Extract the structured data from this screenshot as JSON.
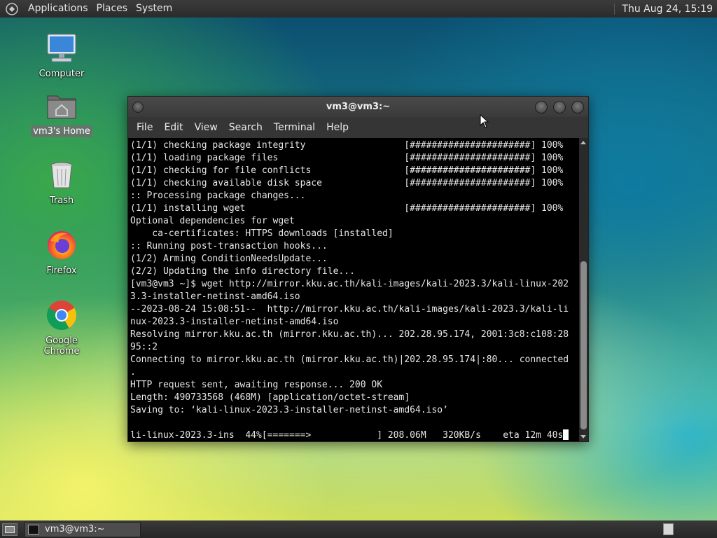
{
  "top_panel": {
    "menus": [
      "Applications",
      "Places",
      "System"
    ],
    "clock": "Thu Aug 24, 15:19"
  },
  "desktop_icons": [
    {
      "label": "Computer",
      "icon": "computer-icon"
    },
    {
      "label": "vm3's Home",
      "icon": "home-folder-icon",
      "selected": true
    },
    {
      "label": "Trash",
      "icon": "trash-icon"
    },
    {
      "label": "Firefox",
      "icon": "firefox-icon"
    },
    {
      "label": "Google Chrome",
      "icon": "chrome-icon"
    }
  ],
  "window": {
    "title": "vm3@vm3:~",
    "menus": [
      "File",
      "Edit",
      "View",
      "Search",
      "Terminal",
      "Help"
    ],
    "lines": [
      "(1/1) checking package integrity                  [######################] 100%",
      "(1/1) loading package files                       [######################] 100%",
      "(1/1) checking for file conflicts                 [######################] 100%",
      "(1/1) checking available disk space               [######################] 100%",
      ":: Processing package changes...",
      "(1/1) installing wget                             [######################] 100%",
      "Optional dependencies for wget",
      "    ca-certificates: HTTPS downloads [installed]",
      ":: Running post-transaction hooks...",
      "(1/2) Arming ConditionNeedsUpdate...",
      "(2/2) Updating the info directory file...",
      "[vm3@vm3 ~]$ wget http://mirror.kku.ac.th/kali-images/kali-2023.3/kali-linux-202",
      "3.3-installer-netinst-amd64.iso",
      "--2023-08-24 15:08:51--  http://mirror.kku.ac.th/kali-images/kali-2023.3/kali-li",
      "nux-2023.3-installer-netinst-amd64.iso",
      "Resolving mirror.kku.ac.th (mirror.kku.ac.th)... 202.28.95.174, 2001:3c8:c108:28",
      "95::2",
      "Connecting to mirror.kku.ac.th (mirror.kku.ac.th)|202.28.95.174|:80... connected",
      ".",
      "HTTP request sent, awaiting response... 200 OK",
      "Length: 490733568 (468M) [application/octet-stream]",
      "Saving to: ‘kali-linux-2023.3-installer-netinst-amd64.iso’",
      "",
      "li-linux-2023.3-ins  44%[=======>            ] 208.06M   320KB/s    eta 12m 40s"
    ]
  },
  "taskbar": {
    "task_label": "vm3@vm3:~"
  }
}
